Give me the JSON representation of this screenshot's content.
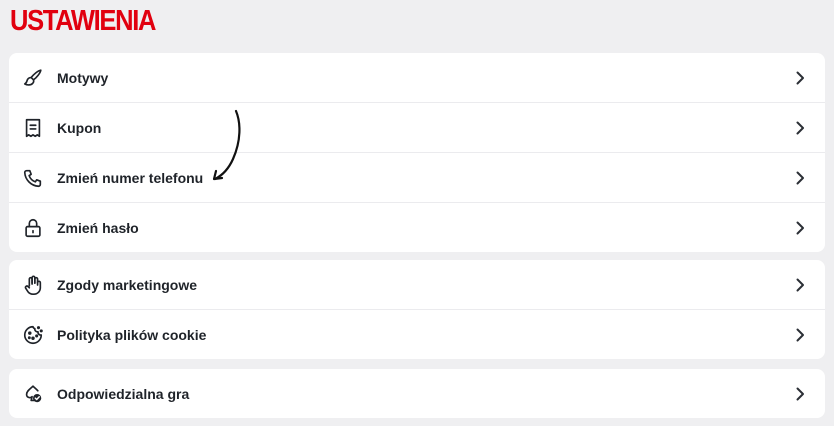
{
  "page": {
    "title": "USTAWIENIA"
  },
  "groups": [
    {
      "items": [
        {
          "label": "Motywy",
          "icon": "brush-icon"
        },
        {
          "label": "Kupon",
          "icon": "receipt-icon"
        },
        {
          "label": "Zmień numer telefonu",
          "icon": "phone-icon"
        },
        {
          "label": "Zmień hasło",
          "icon": "lock-icon"
        }
      ]
    },
    {
      "items": [
        {
          "label": "Zgody marketingowe",
          "icon": "hand-icon"
        },
        {
          "label": "Polityka plików cookie",
          "icon": "cookie-icon"
        }
      ]
    },
    {
      "items": [
        {
          "label": "Odpowiedzialna gra",
          "icon": "responsible-gaming-icon"
        }
      ]
    }
  ],
  "colors": {
    "accent": "#e1000f",
    "background": "#efeff1",
    "text": "#1f2329"
  }
}
